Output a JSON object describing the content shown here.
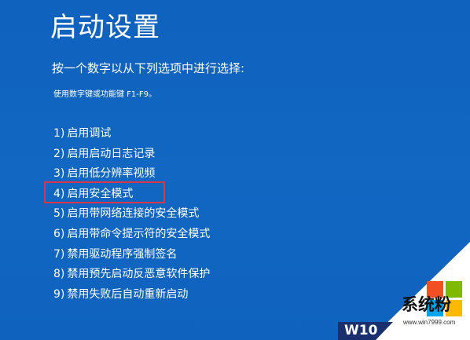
{
  "screen": {
    "title": "启动设置",
    "prompt": "按一个数字以从下列选项中进行选择:",
    "hint": "使用数字键或功能键 F1-F9。",
    "options": [
      {
        "num": "1)",
        "label": "启用调试"
      },
      {
        "num": "2)",
        "label": "启用启动日志记录"
      },
      {
        "num": "3)",
        "label": "启用低分辨率视频"
      },
      {
        "num": "4)",
        "label": "启用安全模式"
      },
      {
        "num": "5)",
        "label": "启用带网络连接的安全模式"
      },
      {
        "num": "6)",
        "label": "启用带命令提示符的安全模式"
      },
      {
        "num": "7)",
        "label": "禁用驱动程序强制签名"
      },
      {
        "num": "8)",
        "label": "禁用预先启动反恶意软件保护"
      },
      {
        "num": "9)",
        "label": "禁用失败后自动重新启动"
      }
    ]
  },
  "watermark": {
    "badge_text": "W10",
    "logo_text": "系统粉",
    "logo_url": "www.win7999.com"
  },
  "colors": {
    "background": "#1167C2",
    "text": "#FFFFFF",
    "highlight_border": "#D9364A",
    "ms_red": "#F25022",
    "ms_green": "#7FBA00",
    "ms_blue": "#00A4EF",
    "ms_yellow": "#FFB900"
  }
}
